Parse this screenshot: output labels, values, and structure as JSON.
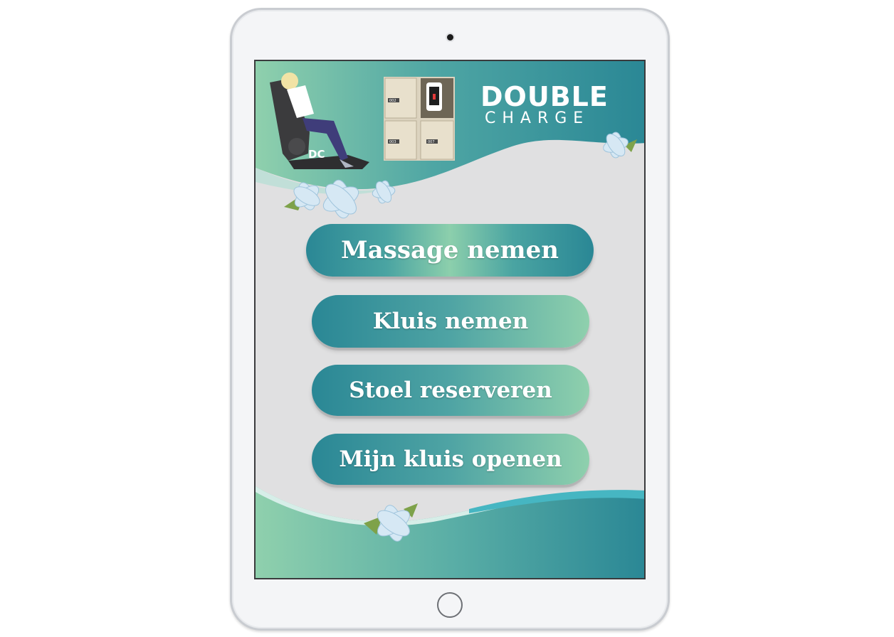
{
  "app": {
    "brand_top": "DOUBLE",
    "brand_bottom": "CHARGE",
    "chair_mark": "DC"
  },
  "colors": {
    "teal_dark": "#2a8795",
    "teal_mid": "#4fa4a4",
    "mint": "#8fd0ad",
    "screen_bg": "#e0e0e1"
  },
  "lockers": {
    "numbers": [
      "002",
      "003",
      "007"
    ]
  },
  "menu": {
    "items": [
      {
        "label": "Massage nemen"
      },
      {
        "label": "Kluis nemen"
      },
      {
        "label": "Stoel reserveren"
      },
      {
        "label": "Mijn kluis openen"
      }
    ]
  },
  "icons": [
    "flower-icon",
    "phone-charging-icon",
    "massage-chair-illustration"
  ]
}
